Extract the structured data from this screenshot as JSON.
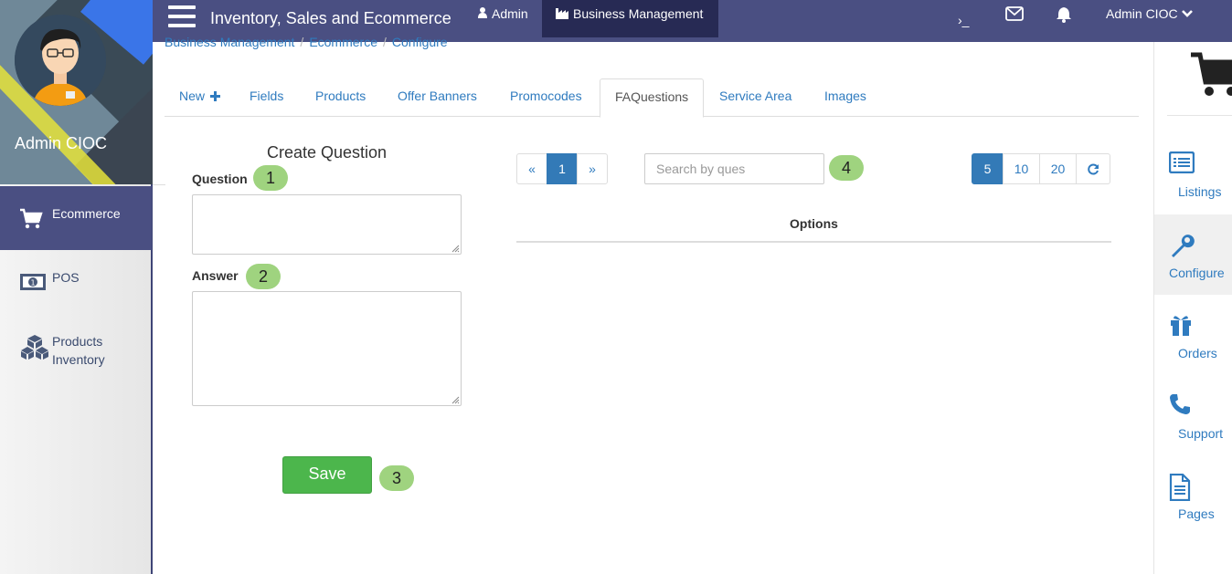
{
  "topbar": {
    "app_title": "Inventory, Sales and Ecommerce",
    "admin_label": "Admin",
    "business_label": "Business Management",
    "terminal_glyph": "›_",
    "user_label": "Admin CIOC"
  },
  "sidebar": {
    "profile_name": "Admin CIOC",
    "items": [
      {
        "label": "Ecommerce",
        "icon": "cart-icon",
        "active": true
      },
      {
        "label": "POS",
        "icon": "money-icon",
        "active": false
      },
      {
        "label": "Products Inventory",
        "icon": "cubes-icon",
        "active": false
      }
    ]
  },
  "breadcrumb": [
    "Business Management",
    "Ecommerce",
    "Configure"
  ],
  "tabs": [
    {
      "label": "New"
    },
    {
      "label": "Fields"
    },
    {
      "label": "Products"
    },
    {
      "label": "Offer Banners"
    },
    {
      "label": "Promocodes"
    },
    {
      "label": "FAQuestions",
      "active": true
    },
    {
      "label": "Service Area"
    },
    {
      "label": "Images"
    }
  ],
  "form": {
    "title": "Create Question",
    "question_label": "Question",
    "answer_label": "Answer",
    "question_value": "",
    "answer_value": "",
    "save_label": "Save"
  },
  "badges": [
    "1",
    "2",
    "3",
    "4"
  ],
  "pager": {
    "prev": "«",
    "current": "1",
    "next": "»"
  },
  "search": {
    "placeholder": "Search by ques",
    "value": ""
  },
  "page_sizes": [
    "5",
    "10",
    "20"
  ],
  "table": {
    "header": "Options"
  },
  "rightbar": {
    "items": [
      {
        "label": "Listings",
        "icon": "list-icon"
      },
      {
        "label": "Configure",
        "icon": "wrench-icon",
        "active": true
      },
      {
        "label": "Orders",
        "icon": "gift-icon"
      },
      {
        "label": "Support",
        "icon": "phone-icon"
      },
      {
        "label": "Pages",
        "icon": "file-icon"
      }
    ]
  },
  "colors": {
    "navbar": "#4a4f82",
    "navbar_active": "#272a54",
    "link": "#2f7bbf",
    "primary": "#337ab7",
    "success": "#4cb64c",
    "badge": "#9fd37f"
  }
}
